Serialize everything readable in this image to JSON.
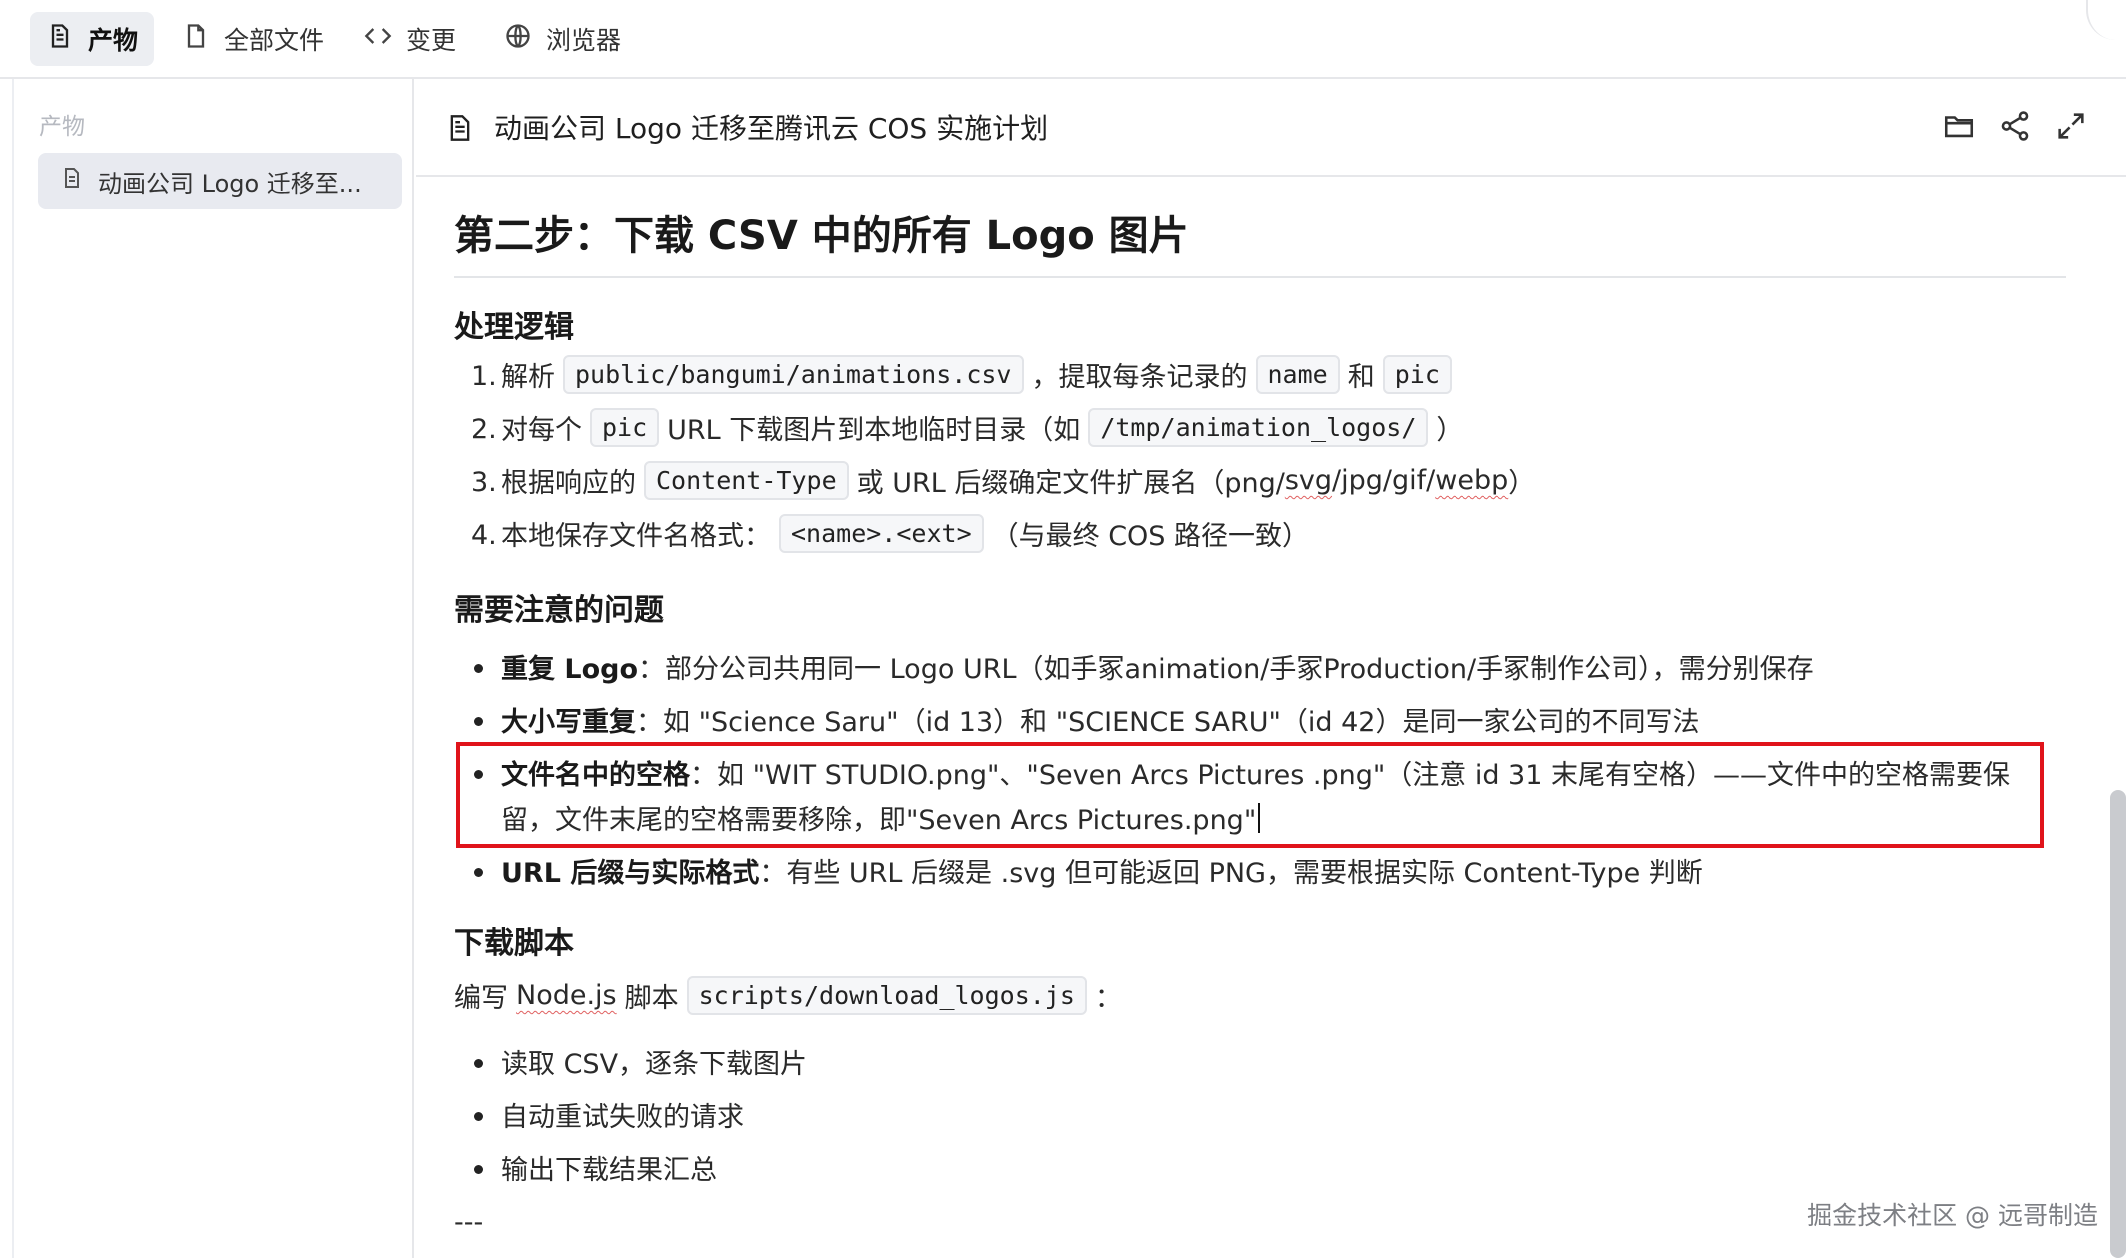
{
  "tabs": [
    {
      "label": "产物",
      "icon": "document-icon",
      "active": true
    },
    {
      "label": "全部文件",
      "icon": "file-icon",
      "active": false
    },
    {
      "label": "变更",
      "icon": "code-icon",
      "active": false
    },
    {
      "label": "浏览器",
      "icon": "globe-icon",
      "active": false
    }
  ],
  "sidebar": {
    "title": "产物",
    "items": [
      {
        "label": "动画公司 Logo 迁移至..."
      }
    ]
  },
  "doc": {
    "title": "动画公司 Logo 迁移至腾讯云 COS 实施计划",
    "actions": [
      "folder-icon",
      "share-icon",
      "expand-icon"
    ]
  },
  "content": {
    "heading": "第二步：下载 CSV 中的所有 Logo 图片",
    "section1": {
      "title": "处理逻辑",
      "items": [
        {
          "n": "1.",
          "t1": "解析",
          "c1": "public/bangumi/animations.csv",
          "t2": "，提取每条记录的",
          "c2": "name",
          "t3": "和",
          "c3": "pic",
          "t4": ""
        },
        {
          "n": "2.",
          "t1": "对每个",
          "c1": "pic",
          "t2": "URL 下载图片到本地临时目录（如",
          "c2": "/tmp/animation_logos/",
          "t3": "）"
        },
        {
          "n": "3.",
          "t1": "根据响应的",
          "c1": "Content-Type",
          "t2": "或 URL 后缀确定文件扩展名（png/",
          "s1": "svg",
          "t3": "/jpg/gif/",
          "s2": "webp",
          "t4": "）"
        },
        {
          "n": "4.",
          "t1": "本地保存文件名格式：",
          "c1": "<name>.<ext>",
          "t2": "（与最终 COS 路径一致）"
        }
      ]
    },
    "section2": {
      "title": "需要注意的问题",
      "items": [
        {
          "bold": "重复 Logo",
          "text": "：部分公司共用同一 Logo URL（如手冢animation/手冢Production/手冢制作公司），需分别保存"
        },
        {
          "bold": "大小写重复",
          "text": "：如 \"Science Saru\"（id 13）和 \"SCIENCE SARU\"（id 42）是同一家公司的不同写法"
        },
        {
          "bold": "文件名中的空格",
          "text": "：如 \"WIT STUDIO.png\"、\"Seven Arcs Pictures .png\"（注意 id 31 末尾有空格）——文件中的空格需要保",
          "text2": "留，文件末尾的空格需要移除，即\"Seven Arcs Pictures.png\""
        },
        {
          "bold": "URL 后缀与实际格式",
          "text": "：有些 URL 后缀是 .svg 但可能返回 PNG，需要根据实际 Content-Type 判断"
        }
      ]
    },
    "section3": {
      "title": "下载脚本",
      "intro1": "编写",
      "intro_link": "Node.js",
      "intro2": "脚本",
      "intro_code": "scripts/download_logos.js",
      "intro3": "：",
      "items": [
        "读取 CSV，逐条下载图片",
        "自动重试失败的请求",
        "输出下载结果汇总"
      ]
    },
    "trailing": "---"
  },
  "watermark": "掘金技术社区 @ 远哥制造",
  "colors": {
    "highlight_border": "#e0131a",
    "active_tab": "#eceef2"
  }
}
